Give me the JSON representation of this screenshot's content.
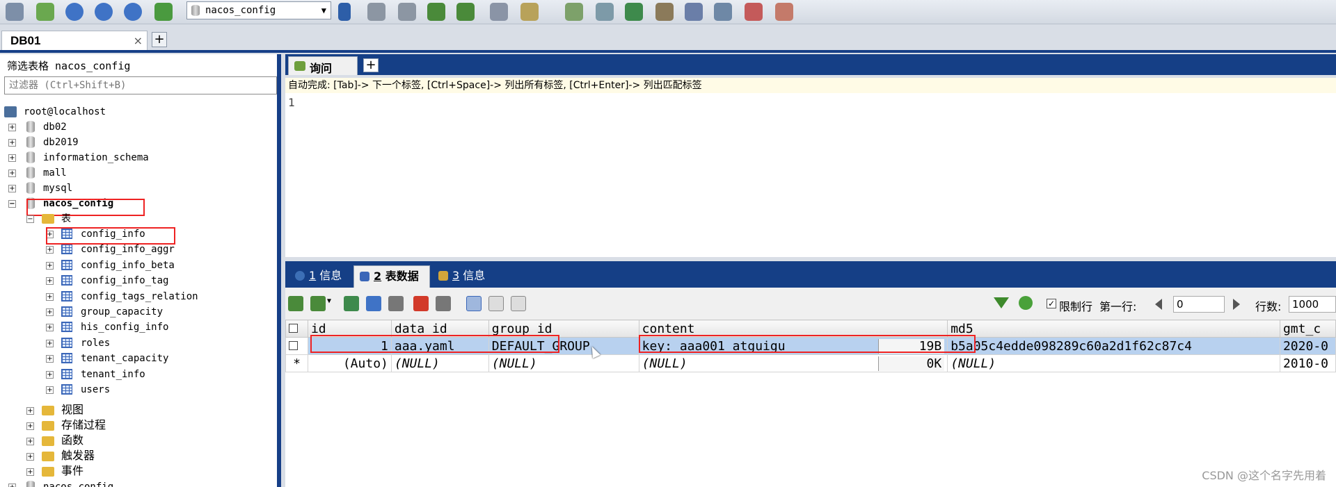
{
  "toolbar": {
    "db_selector": "nacos_config"
  },
  "connection_tabs": [
    {
      "label": "DB01",
      "close": "×"
    }
  ],
  "object_browser": {
    "filter_label": "筛选表格 nacos_config",
    "filter_placeholder": "过滤器 (Ctrl+Shift+B)",
    "server": "root@localhost",
    "databases": [
      "db02",
      "db2019",
      "information_schema",
      "mall",
      "mysql",
      "nacos_config"
    ],
    "tables_folder": "表",
    "tables": [
      "config_info",
      "config_info_aggr",
      "config_info_beta",
      "config_info_tag",
      "config_tags_relation",
      "group_capacity",
      "his_config_info",
      "roles",
      "tenant_capacity",
      "tenant_info",
      "users"
    ],
    "other_folders": [
      "视图",
      "存储过程",
      "函数",
      "触发器",
      "事件"
    ],
    "next_db": "nacos_config"
  },
  "query": {
    "tab_label": "询问",
    "autocomplete_hint": "自动完成: [Tab]-> 下一个标签, [Ctrl+Space]-> 列出所有标签, [Ctrl+Enter]-> 列出匹配标签",
    "line_number": "1"
  },
  "result_tabs": [
    {
      "num": "1",
      "label": " 信息"
    },
    {
      "num": "2",
      "label": " 表数据"
    },
    {
      "num": "3",
      "label": " 信息"
    }
  ],
  "result_toolbar": {
    "limit_label": "限制行",
    "first_row_label": "第一行:",
    "first_row_value": "0",
    "rows_label": "行数:",
    "rows_value": "1000"
  },
  "grid": {
    "columns": [
      "id",
      "data_id",
      "group_id",
      "content",
      "md5",
      "gmt_c"
    ],
    "rows": [
      {
        "id": "1",
        "data_id": "aaa.yaml",
        "group_id": "DEFAULT_GROUP",
        "content": "key: aaa001 atguigu",
        "content_size": "19B",
        "md5": "b5a05c4edde098289c60a2d1f62c87c4",
        "gmt": "2020-0"
      },
      {
        "id": "(Auto)",
        "data_id": "(NULL)",
        "group_id": "(NULL)",
        "content": "(NULL)",
        "content_size": "0K",
        "md5": "(NULL)",
        "gmt": "2010-0"
      }
    ],
    "new_row_marker": "*"
  },
  "watermark": "CSDN @这个名字先用着"
}
